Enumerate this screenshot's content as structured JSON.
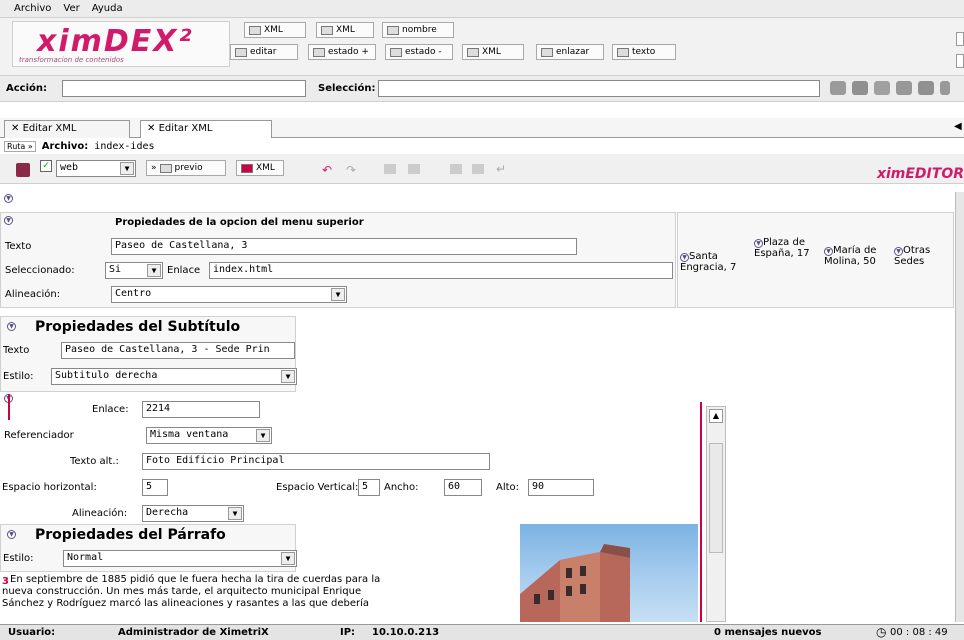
{
  "menu": {
    "items": [
      "Archivo",
      "Ver",
      "Ayuda"
    ]
  },
  "logo": {
    "title": "ximDEX²",
    "subtitle": "transformacion de contenidos"
  },
  "toolbar": {
    "row1": [
      "XML",
      "XML",
      "nombre"
    ],
    "row2": [
      "editar",
      "estado +",
      "estado -",
      "XML",
      "enlazar",
      "texto"
    ]
  },
  "action_bar": {
    "accion_label": "Acción:",
    "accion_value": "",
    "seleccion_label": "Selección:",
    "seleccion_value": ""
  },
  "tabs": [
    {
      "label": "Editar XML"
    },
    {
      "label": "Editar XML"
    }
  ],
  "ruta": {
    "ruta_label": "Ruta »",
    "archivo_label": "Archivo:",
    "archivo_value": "index-ides"
  },
  "editor_bar": {
    "view_select": "web",
    "previo": "previo",
    "xml": "XML",
    "brand": "ximEDITOR"
  },
  "menu_props": {
    "heading": "Propiedades de la opcion del menu superior",
    "texto_label": "Texto",
    "texto_value": "Paseo de Castellana, 3",
    "seleccionado_label": "Seleccionado:",
    "seleccionado_value": "Si",
    "enlace_label": "Enlace",
    "enlace_value": "index.html",
    "alineacion_label": "Alineación:",
    "alineacion_value": "Centro"
  },
  "menu_options": [
    {
      "label": "Santa Engracia, 7"
    },
    {
      "label": "Plaza de España, 17"
    },
    {
      "label": "María de Molina, 50"
    },
    {
      "label": "Otras Sedes"
    }
  ],
  "subtitle_props": {
    "heading": "Propiedades del Subtítulo",
    "texto_label": "Texto",
    "texto_value": "Paseo de Castellana, 3 - Sede Prin",
    "estilo_label": "Estilo:",
    "estilo_value": "Subtitulo derecha"
  },
  "image_props": {
    "enlace_label": "Enlace:",
    "enlace_value": "2214",
    "referenciador_label": "Referenciador",
    "referenciador_value": "Misma ventana",
    "alt_label": "Texto alt.:",
    "alt_value": "Foto Edificio Principal",
    "esp_h_label": "Espacio horizontal:",
    "esp_h_value": "5",
    "esp_v_label": "Espacio Vertical:",
    "esp_v_value": "5",
    "ancho_label": "Ancho:",
    "ancho_value": "60",
    "alto_label": "Alto:",
    "alto_value": "90",
    "alineacion_label": "Alineación:",
    "alineacion_value": "Derecha"
  },
  "paragraph_props": {
    "heading": "Propiedades del Párrafo",
    "estilo_label": "Estilo:",
    "estilo_value": "Normal",
    "line1": "En septiembre de 1885 pidió que le fuera hecha la tira de cuerdas para la",
    "line2": "nueva construcción. Un mes más tarde, el arquitecto municipal Enrique",
    "line3": "Sánchez y Rodríguez marcó las alineaciones y rasantes a las que debería"
  },
  "status": {
    "usuario_label": "Usuario:",
    "usuario_value": "Administrador de XimetriX",
    "ip_label": "IP:",
    "ip_value": "10.10.0.213",
    "messages": "0 mensajes nuevos",
    "time": "00 : 08 : 49"
  },
  "colors": {
    "brand": "#d21a6a",
    "panel": "#f7f7f7",
    "icon_accent": "#5a4f8a"
  }
}
